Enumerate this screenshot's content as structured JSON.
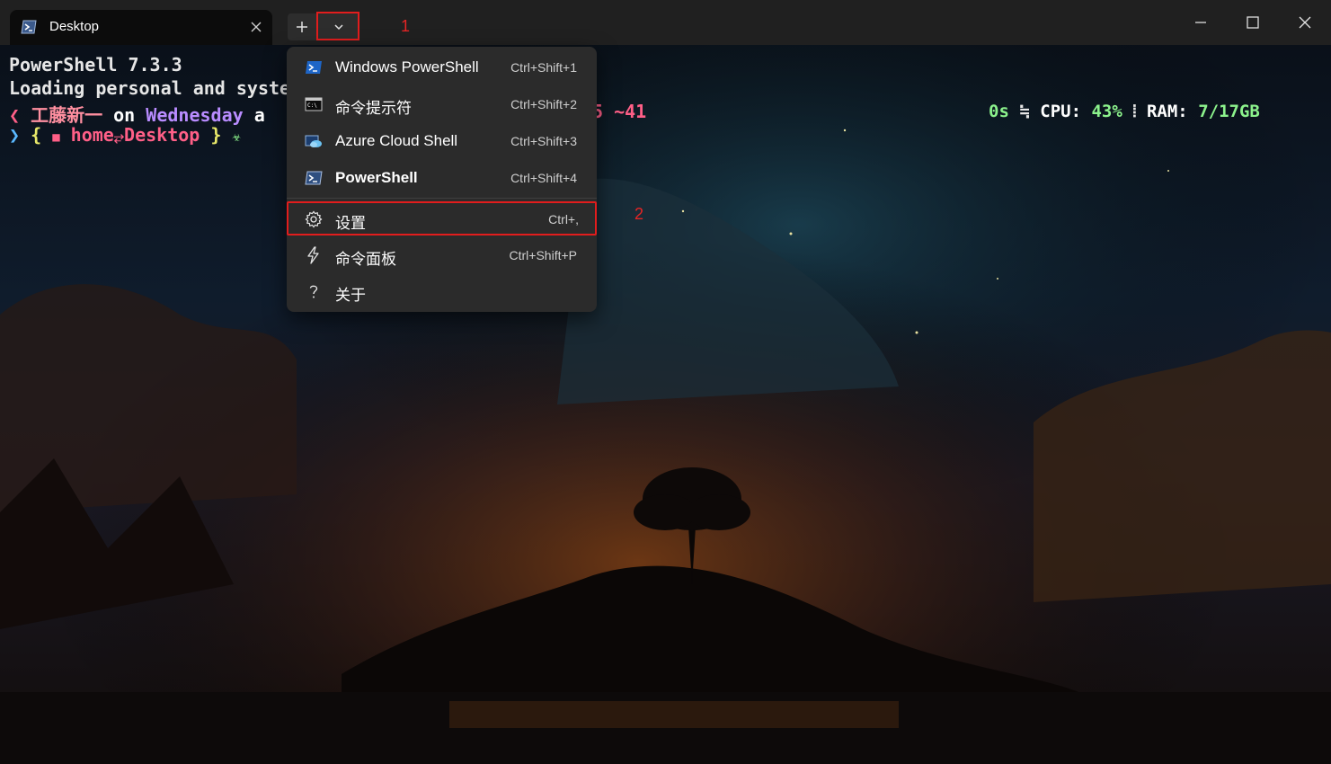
{
  "tab": {
    "title": "Desktop",
    "icon": "powershell-icon"
  },
  "titlebar": {
    "annotation_1": "1",
    "new_tab_icon": "plus-icon",
    "dropdown_icon": "chevron-down-icon",
    "minimize_icon": "minimize-icon",
    "maximize_icon": "maximize-icon",
    "close_icon": "close-icon"
  },
  "terminal": {
    "line1": "PowerShell 7.3.3",
    "line2": "Loading personal and syste",
    "prompt1": {
      "arrow": "❮",
      "user": "工藤新一",
      "on": "on",
      "day": "Wednesday",
      "at": "a",
      "tail": "5 ~41"
    },
    "prompt2": {
      "arrow": "❯",
      "open": "{",
      "folder_icon": "■",
      "home": "home",
      "sep": "⥂",
      "dir": "Desktop",
      "close": "}",
      "symbol": "☣"
    },
    "status": {
      "time": "0s",
      "cpu_label": "CPU:",
      "cpu_value": "43%",
      "ram_label": "RAM:",
      "ram_value": "7/17GB",
      "sep": "⦙",
      "cpu_icon": "≒"
    }
  },
  "menu": {
    "annotation_2": "2",
    "items": [
      {
        "label": "Windows PowerShell",
        "shortcut": "Ctrl+Shift+1",
        "icon": "windows-powershell-icon"
      },
      {
        "label": "命令提示符",
        "shortcut": "Ctrl+Shift+2",
        "icon": "command-prompt-icon"
      },
      {
        "label": "Azure Cloud Shell",
        "shortcut": "Ctrl+Shift+3",
        "icon": "azure-cloud-icon"
      },
      {
        "label": "PowerShell",
        "shortcut": "Ctrl+Shift+4",
        "icon": "powershell-icon"
      },
      {
        "label": "设置",
        "shortcut": "Ctrl+,",
        "icon": "gear-icon"
      },
      {
        "label": "命令面板",
        "shortcut": "Ctrl+Shift+P",
        "icon": "lightning-icon"
      },
      {
        "label": "关于",
        "shortcut": "",
        "icon": "question-icon"
      }
    ]
  },
  "colors": {
    "accent_red": "#e11d1d",
    "menu_bg": "#2b2b2b",
    "titlebar_bg": "#202020"
  }
}
